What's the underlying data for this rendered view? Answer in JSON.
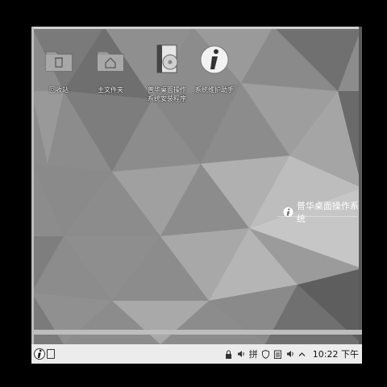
{
  "desktop": {
    "icons": [
      {
        "label": "回收站",
        "icon": "trash-folder-icon"
      },
      {
        "label": "主文件夹",
        "icon": "home-folder-icon"
      },
      {
        "label": "普华桌面操作\n系统安装程序",
        "icon": "installer-disc-icon"
      },
      {
        "label": "系统维护助手",
        "icon": "info-icon"
      }
    ],
    "brand_text": "普华桌面操作系统"
  },
  "taskbar": {
    "ime_label": "拼",
    "clock": "10:22 下午",
    "tray_chevron": "^"
  },
  "colors": {
    "taskbar_bg": "#ececec",
    "wallpaper_base": "#8a8a8a"
  }
}
